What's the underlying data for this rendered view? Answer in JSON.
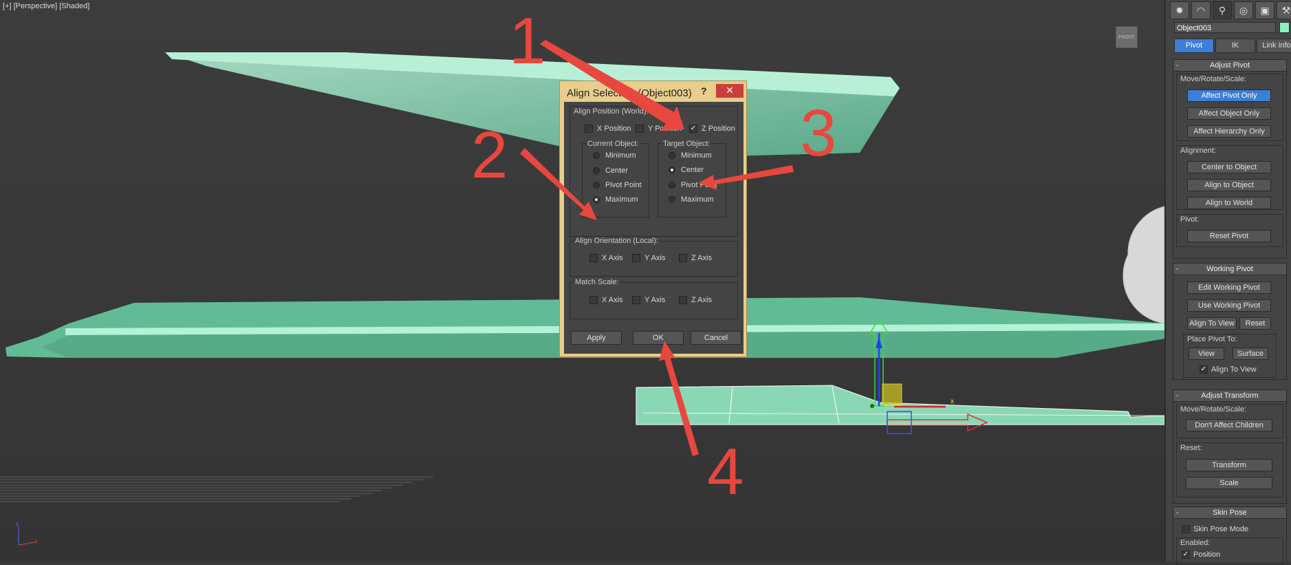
{
  "viewport": {
    "label": "[+] [Perspective] [Shaded]",
    "viewcube_label": "FRONT",
    "axis_x": "x",
    "axis_z": "z",
    "gizmo_x": "x"
  },
  "command_panel": {
    "tabs": [
      "create-icon",
      "modify-icon",
      "hierarchy-icon",
      "motion-icon",
      "display-icon",
      "utilities-icon"
    ],
    "object_name": "Object003",
    "object_color": "#89f0c0",
    "subtabs": [
      "Pivot",
      "IK",
      "Link Info"
    ],
    "adjust_pivot": {
      "title": "Adjust Pivot",
      "move_label": "Move/Rotate/Scale:",
      "affect_pivot_only": "Affect Pivot Only",
      "affect_object_only": "Affect Object Only",
      "affect_hierarchy_only": "Affect Hierarchy Only",
      "alignment_label": "Alignment:",
      "center_to_object": "Center to Object",
      "align_to_object": "Align to Object",
      "align_to_world": "Align to World",
      "pivot_label": "Pivot:",
      "reset_pivot": "Reset Pivot"
    },
    "working_pivot": {
      "title": "Working Pivot",
      "edit": "Edit Working Pivot",
      "use": "Use Working Pivot",
      "align_to_view": "Align To View",
      "reset": "Reset",
      "place_label": "Place Pivot To:",
      "view": "View",
      "surface": "Surface",
      "align_to_view_check": "Align To View"
    },
    "adjust_transform": {
      "title": "Adjust Transform",
      "move_label": "Move/Rotate/Scale:",
      "dont_affect_children": "Don't Affect Children",
      "reset_label": "Reset:",
      "transform": "Transform",
      "scale": "Scale"
    },
    "skin_pose": {
      "title": "Skin Pose",
      "mode": "Skin Pose Mode",
      "enabled_label": "Enabled:",
      "position": "Position"
    }
  },
  "dialog": {
    "title": "Align Selection (Object003)",
    "help": "?",
    "close": "✕",
    "align_position_label": "Align Position (World):",
    "x_position": "X Position",
    "y_position": "Y Position",
    "z_position": "Z Position",
    "current_object_label": "Current Object:",
    "target_object_label": "Target Object:",
    "options": [
      "Minimum",
      "Center",
      "Pivot Point",
      "Maximum"
    ],
    "current_selected": "Maximum",
    "target_selected": "Center",
    "align_orientation_label": "Align Orientation (Local):",
    "match_scale_label": "Match Scale:",
    "x_axis": "X Axis",
    "y_axis": "Y Axis",
    "z_axis": "Z Axis",
    "apply": "Apply",
    "ok": "OK",
    "cancel": "Cancel"
  },
  "annotations": {
    "one": "1",
    "two": "2",
    "three": "3",
    "four": "4",
    "color": "#e8473f"
  }
}
